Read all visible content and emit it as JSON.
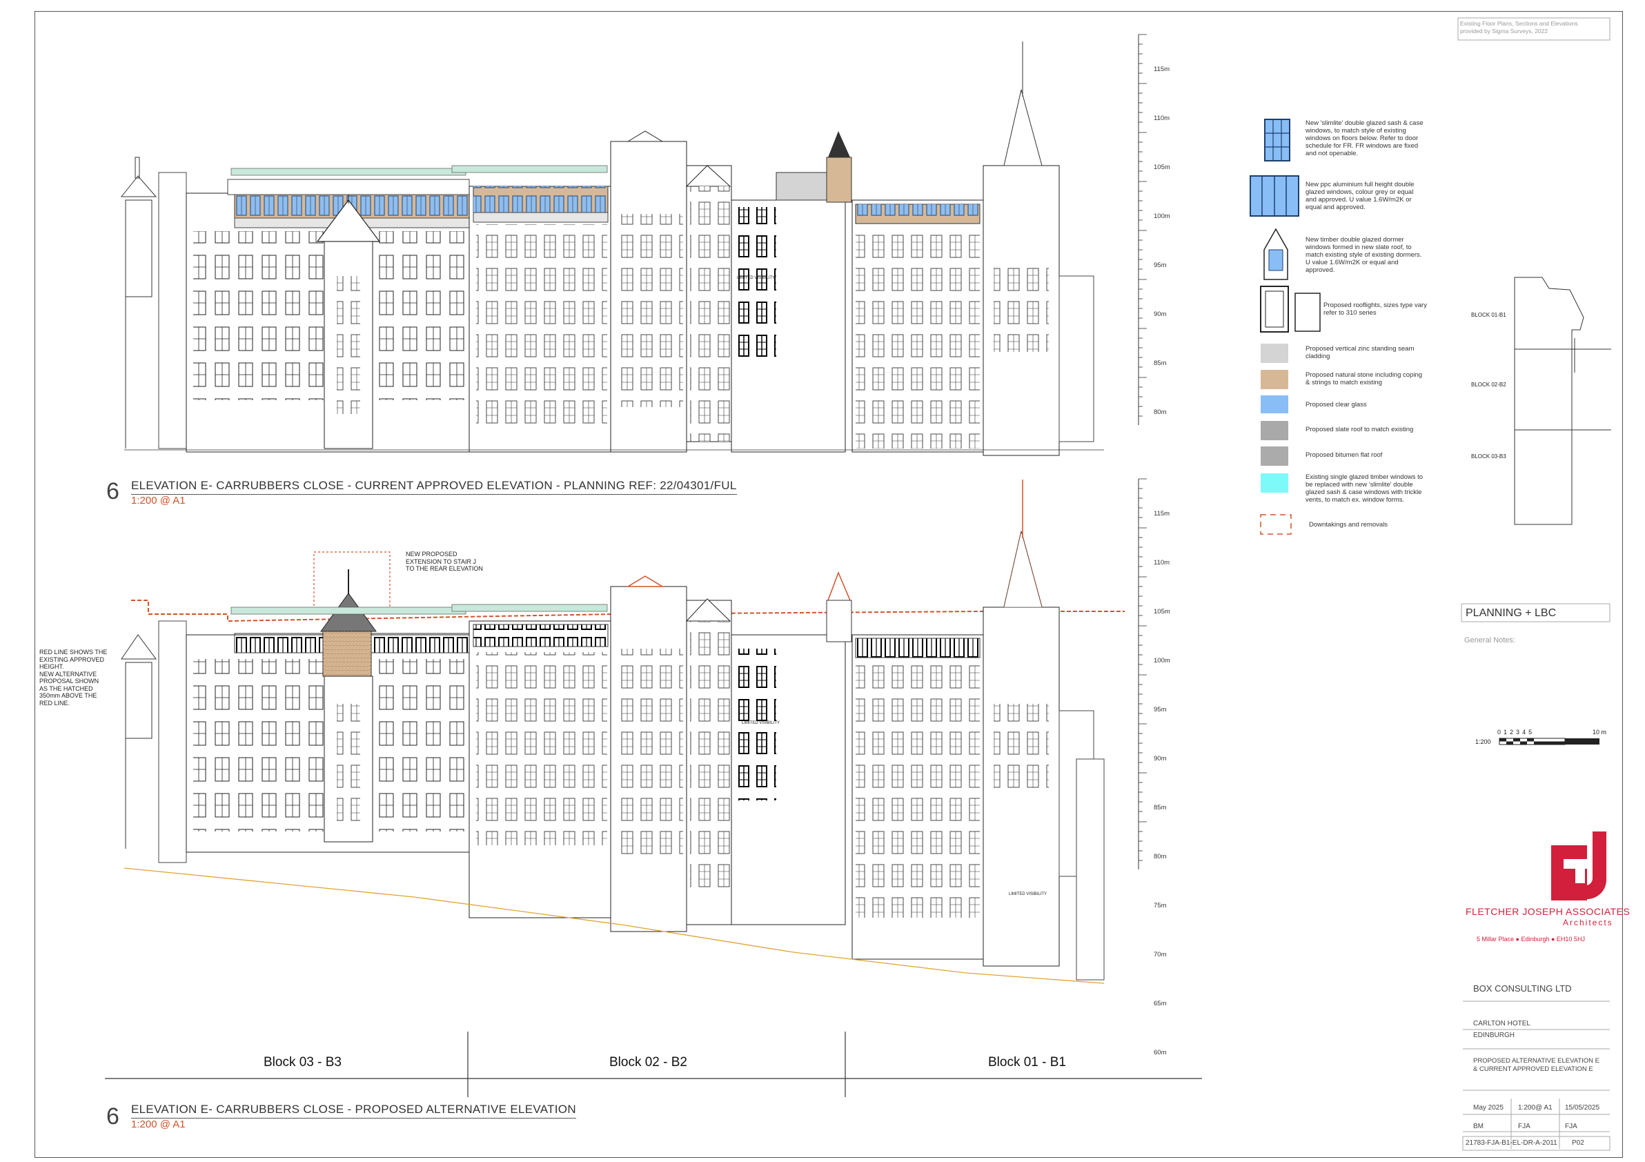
{
  "survey_note": [
    "Existing Floor Plans, Sections and Elevations",
    "provided by Sigma Surveys, 2022"
  ],
  "level_markers": [
    "115m",
    "110m",
    "105m",
    "100m",
    "95m",
    "90m",
    "85m",
    "80m",
    "75m",
    "70m",
    "65m",
    "60m"
  ],
  "view_top": {
    "number": "6",
    "title": "ELEVATION E- CARRUBBERS CLOSE - CURRENT APPROVED ELEVATION - PLANNING REF: 22/04301/FUL",
    "scale": "1:200 @ A1"
  },
  "view_bottom": {
    "number": "6",
    "title": "ELEVATION E- CARRUBBERS CLOSE - PROPOSED ALTERNATIVE ELEVATION",
    "scale": "1:200 @ A1"
  },
  "annotations": {
    "limited_visibility": "LIMITED VISIBILITY",
    "new_proposed": [
      "NEW PROPOSED",
      "EXTENSION TO STAIR J",
      "TO THE REAR ELEVATION"
    ],
    "red_line": [
      "RED LINE SHOWS THE",
      "EXISTING APPROVED",
      "HEIGHT.",
      "NEW ALTERNATIVE",
      "PROPOSAL SHOWN",
      "AS THE HATCHED",
      "350mm ABOVE THE",
      "RED LINE."
    ]
  },
  "blocks": [
    "Block 03 - B3",
    "Block 02 - B2",
    "Block 01 - B1"
  ],
  "legend": [
    {
      "text": [
        "New 'slimlite' double glazed sash & case",
        "windows, to match style of existing",
        "windows on floors below. Refer to door",
        "schedule for FR. FR windows are fixed",
        "and not openable."
      ]
    },
    {
      "text": [
        "New ppc aluminium full height double",
        "glazed windows,  colour grey or equal",
        "and approved. U value 1.6W/m2K or",
        "equal and approved."
      ]
    },
    {
      "text": [
        "New timber  double glazed dormer",
        "windows formed in new slate roof,   to",
        "match existing style of existing dormers.",
        "U value 1.6W/m2K or equal and",
        "approved."
      ]
    },
    {
      "text": [
        "Proposed  rooflights, sizes type vary",
        "refer to 310 series"
      ]
    },
    {
      "color": "#d4d4d4",
      "text": [
        "Proposed vertical zinc standing seam",
        "cladding"
      ]
    },
    {
      "color": "#d7b896",
      "text": [
        "Proposed natural stone including coping",
        "& strings to match existing"
      ]
    },
    {
      "color": "#89bdf6",
      "text": [
        "Proposed clear glass"
      ]
    },
    {
      "color": "#a9a9a9",
      "text": [
        "Proposed slate roof to match existing"
      ]
    },
    {
      "color": "#ababab",
      "text": [
        "Proposed bitumen flat roof"
      ]
    },
    {
      "color": "#7ef9f9",
      "text": [
        "Existing single glazed timber windows to",
        "be replaced with new 'slimlite' double",
        "glazed sash & case windows with trickle",
        "vents, to match ex. window forms."
      ]
    },
    {
      "text": [
        "Downtakings and removals"
      ]
    }
  ],
  "key_plan": [
    "BLOCK 01-B1",
    "BLOCK 02-B2",
    "BLOCK 03-B3"
  ],
  "title_block": {
    "status": "PLANNING + LBC",
    "general_notes_title": "General Notes:",
    "scale_bar": {
      "label": "1:200",
      "ticks": [
        "0",
        "1",
        "2",
        "3",
        "4",
        "5",
        "10 m"
      ]
    },
    "company": "FLETCHER JOSEPH ASSOCIATES",
    "company_sub": "Architects",
    "address": "5 Millar Place  ●  Edinburgh  ●  EH10 5HJ",
    "client": "BOX CONSULTING LTD",
    "project": [
      "CARLTON HOTEL",
      "EDINBURGH"
    ],
    "drawing_title": [
      "PROPOSED ALTERNATIVE ELEVATION E",
      "& CURRENT APPROVED ELEVATION E"
    ],
    "date": "May 2025",
    "scale": "1:200@ A1",
    "last_revision": "15/05/2025",
    "drawn": "BM",
    "checked": "FJA",
    "approved": "FJA",
    "drawing_number": "21783-FJA-B1-EL-DR-A-2011",
    "revision": "P02"
  },
  "colors": {
    "accent": "#d0532a",
    "brand": "#d21f3c",
    "glass": "#89bdf6",
    "stone": "#d7b896"
  }
}
